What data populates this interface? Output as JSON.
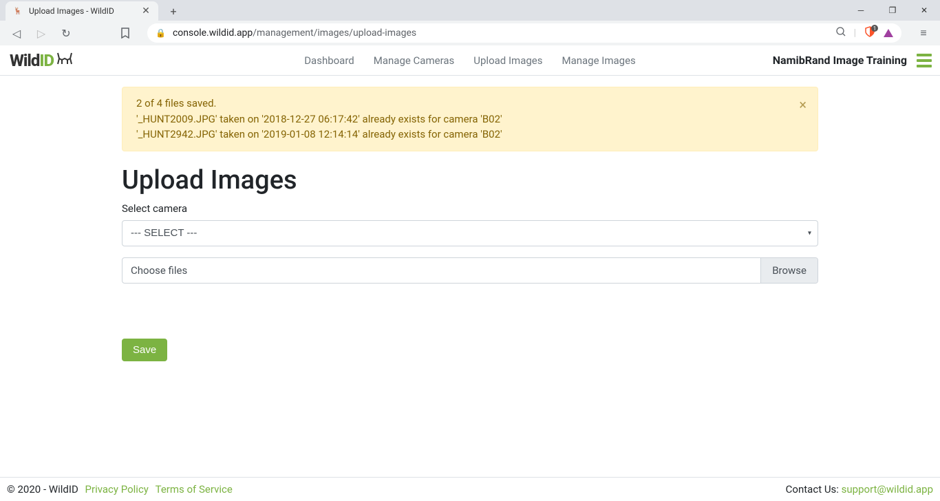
{
  "browser": {
    "tab_title": "Upload Images - WildID",
    "url_host": "console.wildid.app",
    "url_path": "/management/images/upload-images",
    "shield_count": "1"
  },
  "header": {
    "logo_wild": "Wild",
    "logo_id": "ID",
    "nav": {
      "dashboard": "Dashboard",
      "manage_cameras": "Manage Cameras",
      "upload_images": "Upload Images",
      "manage_images": "Manage Images"
    },
    "org_name": "NamibRand Image Training"
  },
  "alert": {
    "line1": "2 of 4 files saved.",
    "line2": "'_HUNT2009.JPG' taken on '2018-12-27 06:17:42' already exists for camera 'B02'",
    "line3": "'_HUNT2942.JPG' taken on '2019-01-08 12:14:14' already exists for camera 'B02'"
  },
  "page": {
    "title": "Upload Images",
    "select_camera_label": "Select camera",
    "select_placeholder": "--- SELECT ---",
    "choose_files": "Choose files",
    "browse": "Browse",
    "save": "Save"
  },
  "footer": {
    "copyright": "© 2020 - WildID",
    "privacy": "Privacy Policy",
    "terms": "Terms of Service",
    "contact_label": "Contact Us: ",
    "contact_email": "support@wildid.app"
  }
}
